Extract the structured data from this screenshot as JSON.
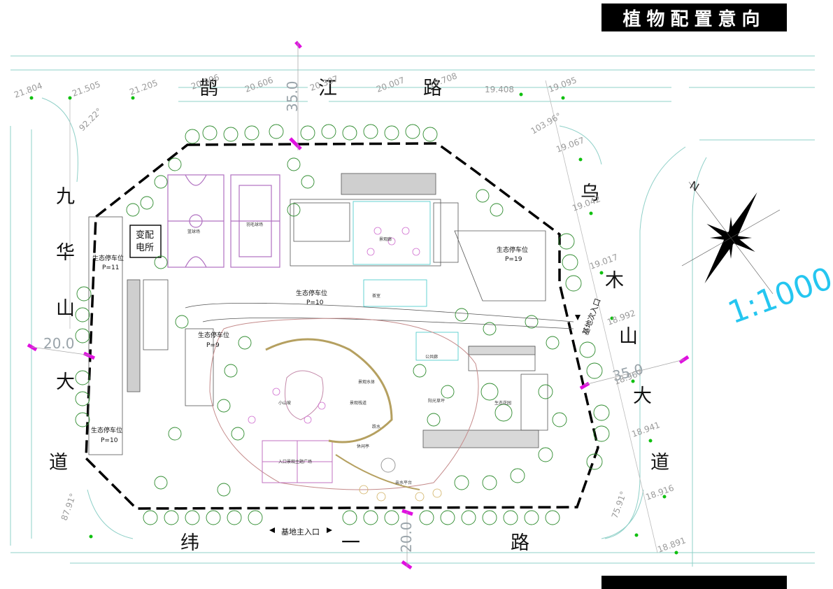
{
  "title": "植物配置意向",
  "scale": "1:1000",
  "compass_letter": "N",
  "roads": {
    "north": [
      "鹊",
      "江",
      "路"
    ],
    "west": [
      "九",
      "华",
      "山",
      "大",
      "道"
    ],
    "east": [
      "乌",
      "木",
      "山",
      "大",
      "道"
    ],
    "south": [
      "纬",
      "一",
      "路"
    ]
  },
  "buildings": {
    "substation": [
      "变配",
      "电所"
    ],
    "basketball": "篮球场",
    "tennis": "羽毛球场",
    "pavilion": "景观廊",
    "teahouse": "茶室",
    "main_entrance": "基地主入口",
    "side_entrance": "基地次入口"
  },
  "parking": {
    "p11": [
      "生态停车位",
      "P=11"
    ],
    "p10_left": [
      "生态停车位",
      "P=10"
    ],
    "p10_top": [
      "生态停车位",
      "P=10"
    ],
    "p9": [
      "生态停车位",
      "P=9"
    ],
    "p19": [
      "生态停车位",
      "P=19"
    ]
  },
  "garden_labels": [
    "小山坡",
    "入口景观主题广场",
    "公共廊",
    "景观水体",
    "休闲亭",
    "景观栈道",
    "跌水",
    "亲水平台",
    "生态花园",
    "阳光草坪"
  ],
  "elevations": {
    "north": [
      "21.804",
      "21.505",
      "21.205",
      "20.906",
      "20.606",
      "20.307",
      "20.007",
      "19.708",
      "19.408",
      "19.095",
      "19.067"
    ],
    "east": [
      "19.042",
      "19.017",
      "18.992",
      "18.967",
      "18.941",
      "18.916",
      "18.891"
    ],
    "angles": [
      "92.22°",
      "103.96°",
      "87.91°",
      "75.91°"
    ],
    "markers": [
      "35.0",
      "20.0",
      "20.0",
      "35.0"
    ]
  }
}
